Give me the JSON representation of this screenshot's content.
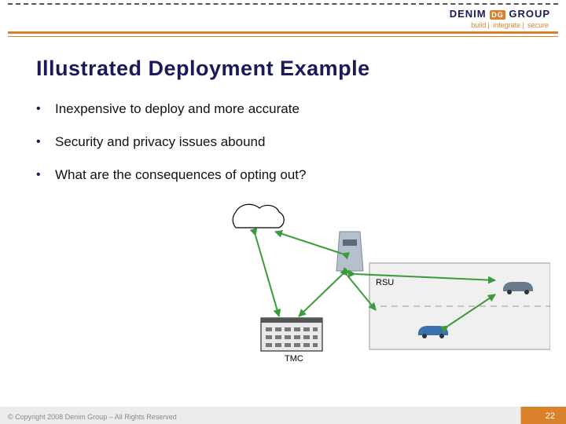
{
  "brand": {
    "name_left": "DENIM",
    "badge": "DG",
    "name_right": "GROUP",
    "tag1": "build",
    "tag2": "integrate",
    "tag3": "secure"
  },
  "title": "Illustrated Deployment Example",
  "bullets": [
    "Inexpensive to deploy and more accurate",
    "Security and privacy issues abound",
    "What are the consequences of opting out?"
  ],
  "diagram": {
    "rsu_label": "RSU",
    "tmc_label": "TMC"
  },
  "footer": {
    "copyright": "© Copyright 2008 Denim Group – All Rights Reserved",
    "page": "22"
  }
}
